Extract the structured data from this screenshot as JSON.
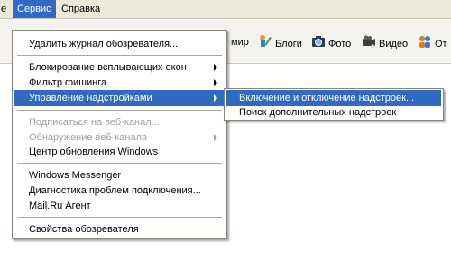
{
  "menubar": {
    "items": [
      {
        "label": "e"
      },
      {
        "label": "Сервис"
      },
      {
        "label": "Справка"
      }
    ]
  },
  "toolbar": {
    "items": [
      {
        "label": "мир",
        "icon": "world-icon"
      },
      {
        "label": "Блоги",
        "icon": "blogs-icon"
      },
      {
        "label": "Фото",
        "icon": "camera-icon"
      },
      {
        "label": "Видео",
        "icon": "video-camera-icon"
      },
      {
        "label": "От",
        "icon": "people-icon"
      }
    ]
  },
  "service_menu": {
    "items": [
      {
        "label": "Удалить журнал обозревателя..."
      },
      {
        "label": "Блокирование всплывающих окон"
      },
      {
        "label": "Фильтр фишинга"
      },
      {
        "label": "Управление надстройками"
      },
      {
        "label": "Подписаться на веб-канал..."
      },
      {
        "label": "Обнаружение веб-канала"
      },
      {
        "label": "Центр обновления Windows"
      },
      {
        "label": "Windows Messenger"
      },
      {
        "label": "Диагностика проблем подключения..."
      },
      {
        "label": "Mail.Ru Агент"
      },
      {
        "label": "Свойства обозревателя"
      }
    ]
  },
  "addons_submenu": {
    "items": [
      {
        "label": "Включение и отключение надстроек..."
      },
      {
        "label": "Поиск дополнительных надстроек"
      }
    ]
  },
  "colors": {
    "highlight": "#316ac5",
    "disabled_text": "#a0a0a0",
    "menu_background": "#ffffff",
    "menubar_background": "#ece9d8"
  }
}
